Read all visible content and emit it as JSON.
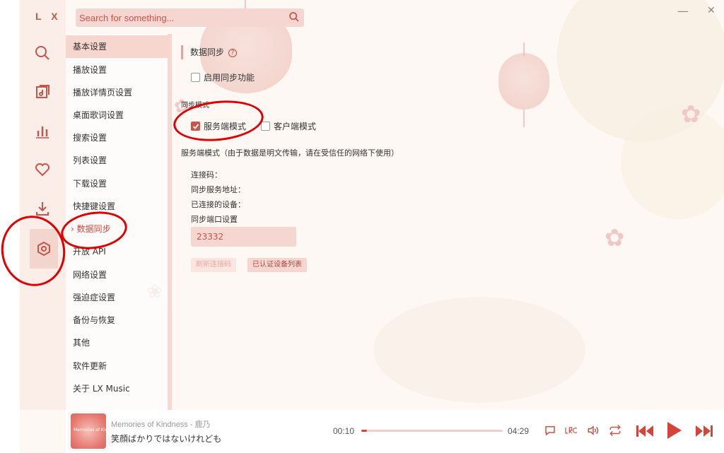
{
  "app": {
    "logo": "L X"
  },
  "search": {
    "placeholder": "Search for something..."
  },
  "window": {
    "minimize": "—",
    "close": "✕"
  },
  "nav_icons": [
    "search-icon",
    "music-note-icon",
    "chart-icon",
    "heart-icon",
    "download-icon",
    "settings-icon"
  ],
  "menu": {
    "items": [
      "基本设置",
      "播放设置",
      "播放详情页设置",
      "桌面歌词设置",
      "搜索设置",
      "列表设置",
      "下载设置",
      "快捷键设置",
      "数据同步",
      "开放 API",
      "网络设置",
      "强迫症设置",
      "备份与恢复",
      "其他",
      "软件更新",
      "关于 LX Music"
    ],
    "active_prefix": "›"
  },
  "sync": {
    "title": "数据同步",
    "help": "?",
    "enable_label": "启用同步功能",
    "enable_checked": false,
    "mode_label": "同步模式",
    "server_mode_label": "服务端模式",
    "server_mode_checked": true,
    "client_mode_label": "客户端模式",
    "client_mode_checked": false,
    "server_mode_note": "服务端模式（由于数据是明文传输，请在受信任的网络下使用）",
    "connection_code_label": "连接码：",
    "sync_address_label": "同步服务地址：",
    "connected_devices_label": "已连接的设备：",
    "port_label": "同步端口设置",
    "port_value": "23332",
    "refresh_code_button": "刷新连接码",
    "auth_devices_button": "已认证设备列表"
  },
  "player": {
    "cover_text": "Memories of Kindness",
    "song_title": "Memories of Kindness - 鹿乃",
    "lyric": "笑顔ばかりではないけれども",
    "current_time": "00:10",
    "total_time": "04:29",
    "progress": 0.04
  },
  "colors": {
    "accent": "#c8554a",
    "annotation": "#e00000"
  }
}
